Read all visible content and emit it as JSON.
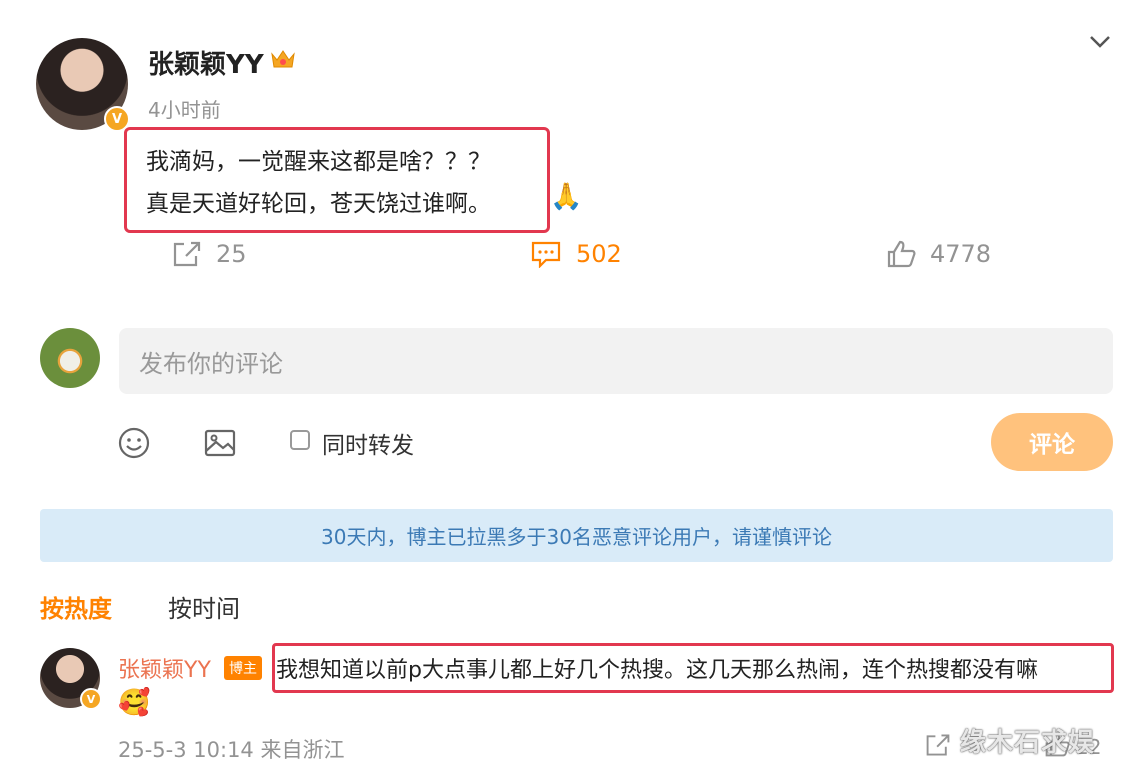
{
  "post": {
    "username": "张颖颖YY",
    "time": "4小时前",
    "verified_mark": "V",
    "lines": [
      "我滴妈，一觉醒来这都是啥？？？",
      "真是天道好轮回，苍天饶过谁啊。"
    ],
    "emoji": "🙏",
    "stats": {
      "share": "25",
      "comment": "502",
      "like": "4778"
    }
  },
  "composer": {
    "placeholder": "发布你的评论",
    "repost_label": "同时转发",
    "submit_label": "评论"
  },
  "notice": "30天内，博主已拉黑多于30名恶意评论用户，请谨慎评论",
  "sort": {
    "hot": "按热度",
    "time": "按时间"
  },
  "comment": {
    "username": "张颖颖YY",
    "badge": "博主",
    "verified_mark": "V",
    "text": "我想知道以前p大点事儿都上好几个热搜。这几天那么热闹，连个热搜都没有嘛",
    "emoji": "🥰",
    "meta": "25-5-3 10:14 来自浙江",
    "like_count": "22"
  },
  "watermark": "缘木石求娱",
  "colors": {
    "accent": "#ff8200",
    "highlight_box": "#e2384f",
    "notice_bg": "#d9ebf8",
    "notice_text": "#3c7ab5"
  },
  "icons": [
    "chevron-down-icon",
    "crown-icon",
    "share-icon",
    "comment-icon",
    "like-icon",
    "emoji-icon",
    "image-icon"
  ]
}
